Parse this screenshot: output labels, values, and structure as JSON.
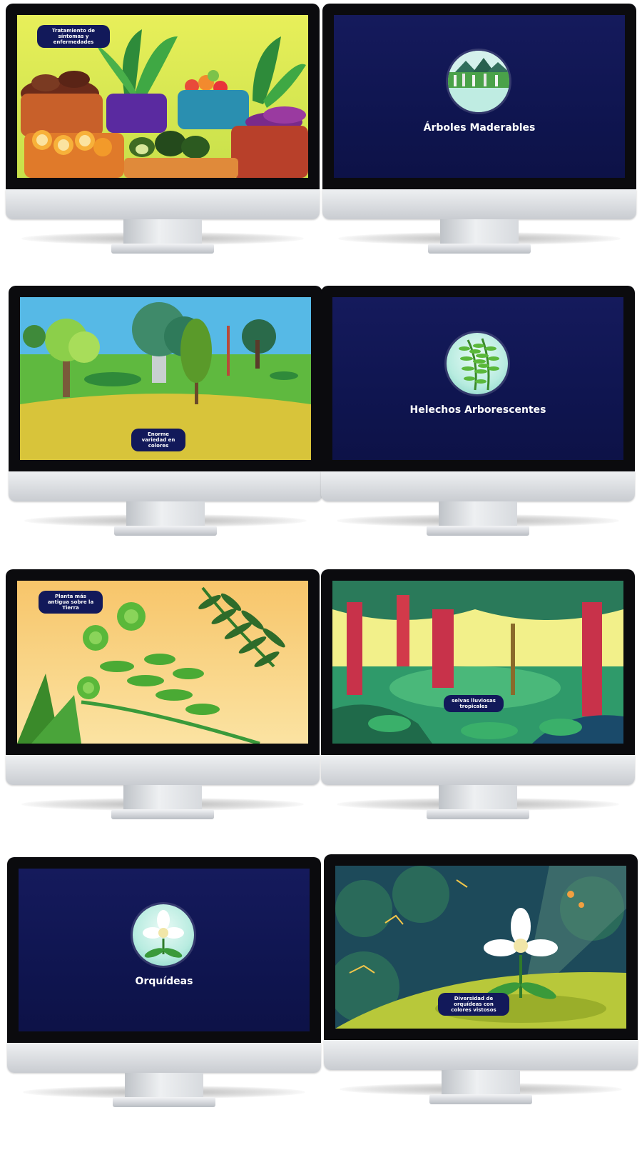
{
  "monitors": [
    {
      "id": 1,
      "caption": "Tratamiento de síntomas y enfermedades"
    },
    {
      "id": 2,
      "title": "Árboles Maderables"
    },
    {
      "id": 3,
      "caption": "Enorme variedad en colores"
    },
    {
      "id": 4,
      "title": "Helechos Arborescentes"
    },
    {
      "id": 5,
      "caption": "Planta más antigua sobre la Tierra"
    },
    {
      "id": 6,
      "caption": "selvas lluviosas tropicales"
    },
    {
      "id": 7,
      "title": "Orquídeas"
    },
    {
      "id": 8,
      "caption": "Diversidad de orquídeas con colores vistosos"
    }
  ],
  "colors": {
    "navy_screen": "#131a58",
    "pill": "#12195a",
    "grass": "#3aa53c",
    "sky": "#4fb8e6"
  }
}
